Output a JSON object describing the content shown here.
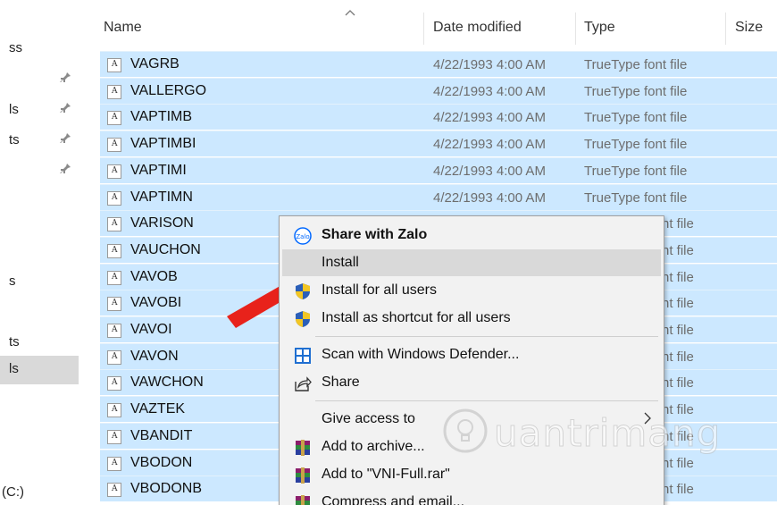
{
  "nav": {
    "items": [
      {
        "label": "ss",
        "pinned": false,
        "selected": false
      },
      {
        "label": "",
        "pinned": true,
        "selected": false
      },
      {
        "label": "ls",
        "pinned": true,
        "selected": false
      },
      {
        "label": "ts",
        "pinned": true,
        "selected": false
      },
      {
        "label": "",
        "pinned": true,
        "selected": false
      },
      {
        "label": "s",
        "pinned": false,
        "selected": false
      },
      {
        "label": "ts",
        "pinned": false,
        "selected": false
      },
      {
        "label": "ls",
        "pinned": false,
        "selected": true
      },
      {
        "label": "(C:)",
        "pinned": false,
        "selected": false
      }
    ]
  },
  "columns": {
    "name": "Name",
    "date": "Date modified",
    "type": "Type",
    "size": "Size"
  },
  "files": [
    {
      "name": "VAGRB",
      "date": "4/22/1993 4:00 AM",
      "type": "TrueType font file"
    },
    {
      "name": "VALLERGO",
      "date": "4/22/1993 4:00 AM",
      "type": "TrueType font file"
    },
    {
      "name": "VAPTIMB",
      "date": "4/22/1993 4:00 AM",
      "type": "TrueType font file"
    },
    {
      "name": "VAPTIMBI",
      "date": "4/22/1993 4:00 AM",
      "type": "TrueType font file"
    },
    {
      "name": "VAPTIMI",
      "date": "4/22/1993 4:00 AM",
      "type": "TrueType font file"
    },
    {
      "name": "VAPTIMN",
      "date": "4/22/1993 4:00 AM",
      "type": "TrueType font file"
    },
    {
      "name": "VARISON",
      "date": "",
      "type": "nt file"
    },
    {
      "name": "VAUCHON",
      "date": "",
      "type": "nt file"
    },
    {
      "name": "VAVOB",
      "date": "",
      "type": "nt file"
    },
    {
      "name": "VAVOBI",
      "date": "",
      "type": "nt file"
    },
    {
      "name": "VAVOI",
      "date": "",
      "type": "nt file"
    },
    {
      "name": "VAVON",
      "date": "",
      "type": "nt file"
    },
    {
      "name": "VAWCHON",
      "date": "",
      "type": "nt file"
    },
    {
      "name": "VAZTEK",
      "date": "",
      "type": "nt file"
    },
    {
      "name": "VBANDIT",
      "date": "",
      "type": "nt file"
    },
    {
      "name": "VBODON",
      "date": "",
      "type": "nt file"
    },
    {
      "name": "VBODONB",
      "date": "",
      "type": "nt file"
    }
  ],
  "context_menu": {
    "share_zalo": "Share with Zalo",
    "install": "Install",
    "install_all": "Install for all users",
    "install_shortcut": "Install as shortcut for all users",
    "scan_defender": "Scan with Windows Defender...",
    "share": "Share",
    "give_access": "Give access to",
    "add_archive": "Add to archive...",
    "add_rar": "Add to \"VNI-Full.rar\"",
    "compress_email": "Compress and email..."
  },
  "icons": {
    "zalo": "zalo-icon",
    "shield": "uac-shield-icon",
    "defender": "windows-defender-icon",
    "share": "share-icon",
    "winrar": "winrar-icon",
    "pin": "pin-icon"
  },
  "colors": {
    "selection": "#cce8ff",
    "menu_bg": "#f2f2f2",
    "menu_hover": "#d9d9d9",
    "arrow": "#e8221b"
  },
  "watermark": {
    "text": "uantrimang"
  }
}
